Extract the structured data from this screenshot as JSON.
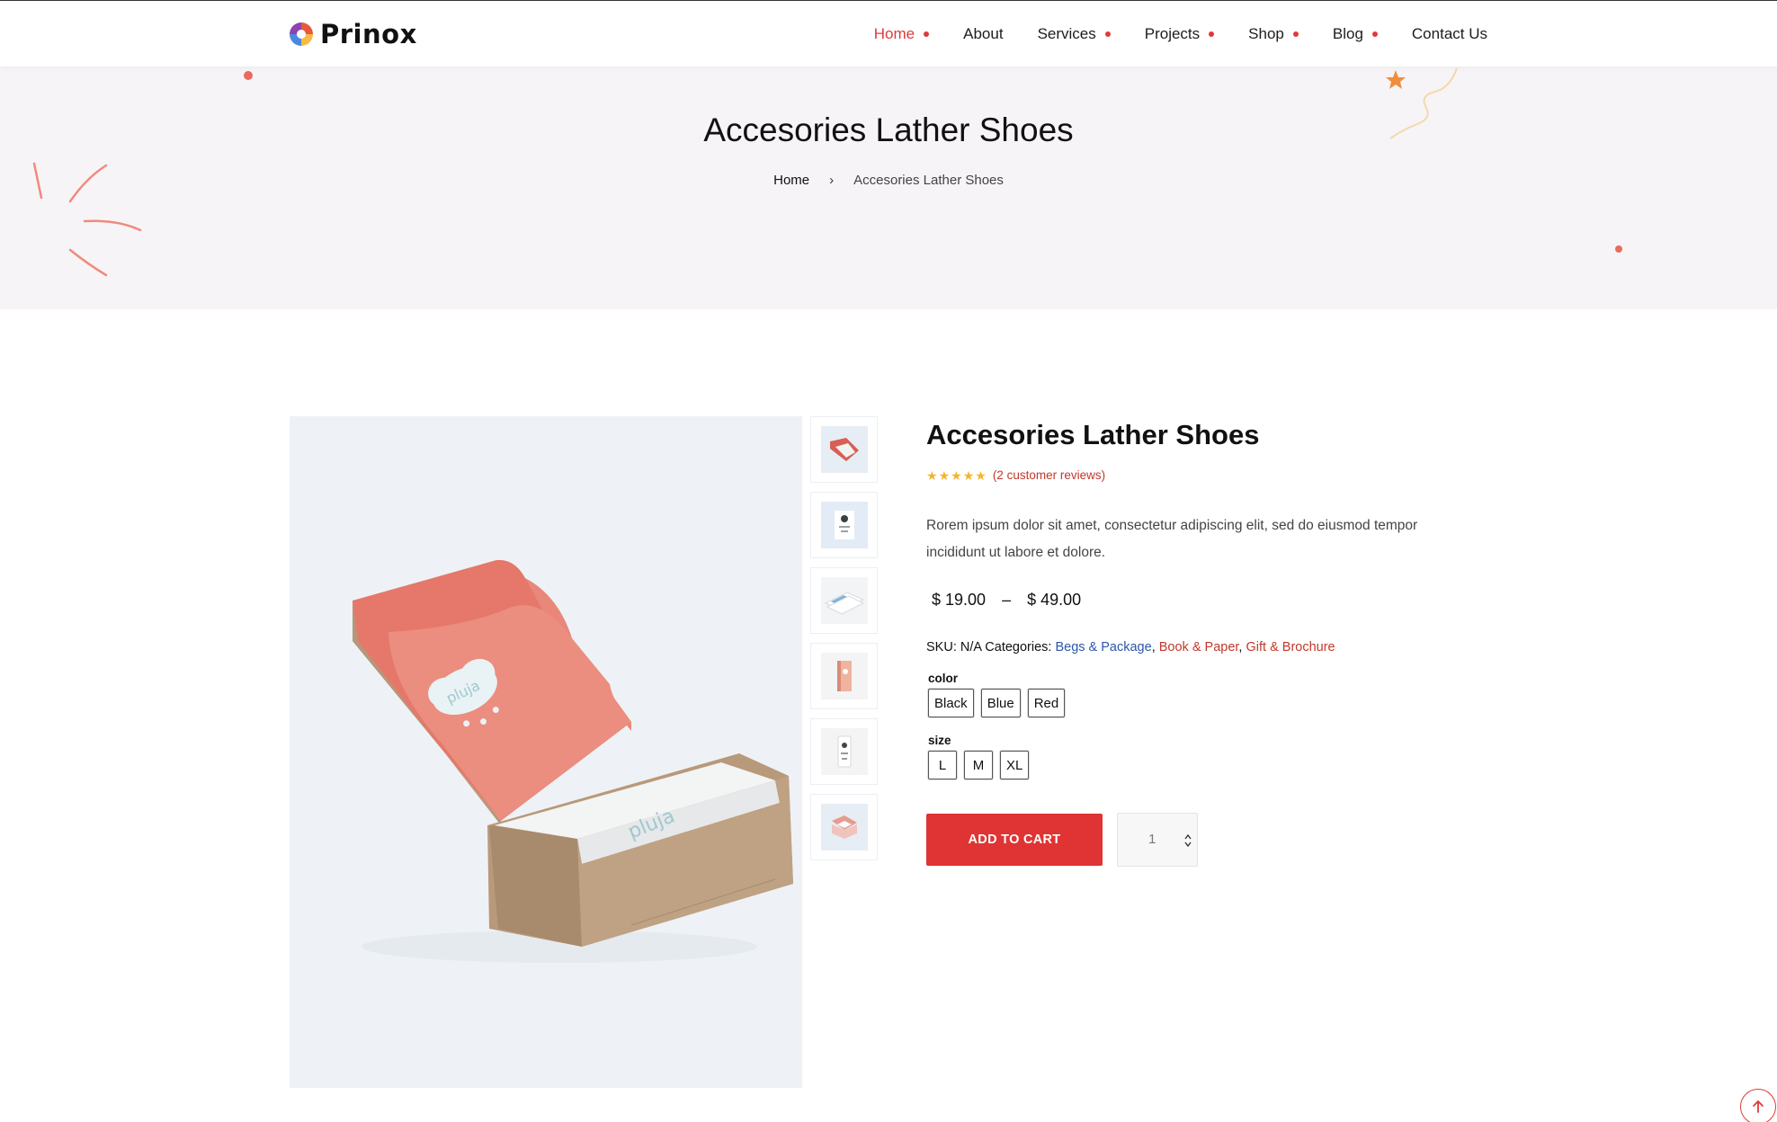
{
  "header": {
    "brand": "Prinox",
    "nav": [
      {
        "label": "Home",
        "dot": true,
        "active": true
      },
      {
        "label": "About",
        "dot": false,
        "active": false
      },
      {
        "label": "Services",
        "dot": true,
        "active": false
      },
      {
        "label": "Projects",
        "dot": true,
        "active": false
      },
      {
        "label": "Shop",
        "dot": true,
        "active": false
      },
      {
        "label": "Blog",
        "dot": true,
        "active": false
      },
      {
        "label": "Contact Us",
        "dot": false,
        "active": false
      }
    ]
  },
  "hero": {
    "title": "Accesories Lather Shoes",
    "breadcrumb": {
      "home": "Home",
      "separator": "›",
      "current": "Accesories Lather Shoes"
    }
  },
  "gallery": {
    "main_image": "pink-mailer-box-image",
    "main_logo_text": "pluja",
    "thumbnails": [
      "pink-box-thumbnail",
      "business-card-thumbnail",
      "stacked-cards-thumbnail",
      "pink-book-thumbnail",
      "white-package-thumbnail",
      "open-box-thumbnail"
    ]
  },
  "product": {
    "title": "Accesories Lather Shoes",
    "rating": 5,
    "reviews_label": "(2 customer reviews)",
    "description": "Rorem ipsum dolor sit amet, consectetur adipiscing elit, sed do eiusmod tempor incididunt ut labore et dolore.",
    "price_min": "$ 19.00",
    "price_dash": "–",
    "price_max": "$ 49.00",
    "sku_label": "SKU:",
    "sku_value": "N/A",
    "categories_label": "Categories:",
    "categories": [
      "Begs & Package",
      "Book & Paper",
      "Gift & Brochure"
    ],
    "color_label": "color",
    "colors": [
      "Black",
      "Blue",
      "Red"
    ],
    "size_label": "size",
    "sizes": [
      "L",
      "M",
      "XL"
    ],
    "add_to_cart": "ADD TO CART",
    "quantity": "1"
  },
  "colors": {
    "accent": "#df3433",
    "star": "#f4b42c",
    "link_blue": "#2d56a8",
    "hero_bg": "#f7f4f7"
  },
  "icons": {
    "breadcrumb_separator": "chevron-right-icon",
    "back_to_top": "arrow-up-icon",
    "quantity_spinner": "spinner-icon"
  }
}
